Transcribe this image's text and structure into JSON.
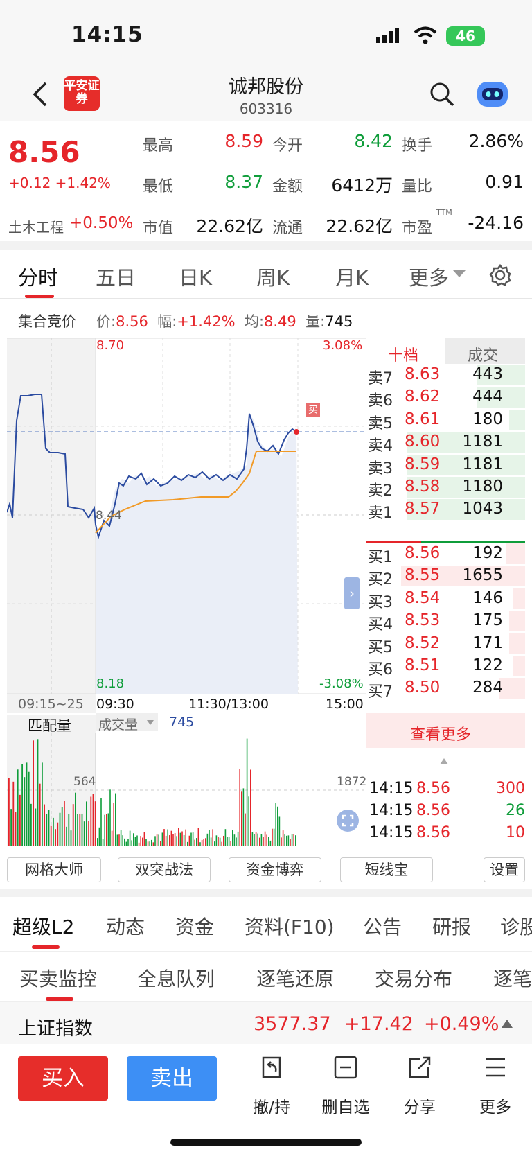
{
  "status": {
    "time": "14:15",
    "battery": "46"
  },
  "header": {
    "title": "诚邦股份",
    "code": "603316",
    "logo": "平安证券"
  },
  "quote": {
    "price": "8.56",
    "change": "+0.12 +1.42%",
    "high_label": "最高",
    "high": "8.59",
    "open_label": "今开",
    "open": "8.42",
    "turn_label": "换手",
    "turn": "2.86%",
    "low_label": "最低",
    "low": "8.37",
    "amt_label": "金额",
    "amt": "6412万",
    "vr_label": "量比",
    "vr": "0.91",
    "sector": "土木工程",
    "sector_chg": "+0.50%",
    "mcap_label": "市值",
    "mcap": "22.62亿",
    "float_label": "流通",
    "float": "22.62亿",
    "pe_label": "市盈",
    "pe_sup": "TTM",
    "pe": "-24.16"
  },
  "chart_tabs": [
    "分时",
    "五日",
    "日K",
    "周K",
    "月K",
    "更多"
  ],
  "info": {
    "auction": "集合竞价",
    "price_label": "价:",
    "price": "8.56",
    "amp_label": "幅:",
    "amp": "+1.42%",
    "avg_label": "均:",
    "avg": "8.49",
    "vol_label": "量:",
    "vol": "745"
  },
  "chart": {
    "ymax": "8.70",
    "ymin": "8.18",
    "pmax": "3.08%",
    "pmin": "-3.08%",
    "mid": "8.44",
    "buy_tag": "买",
    "x0": "09:15~25",
    "x1": "09:30",
    "x2": "11:30/13:00",
    "x3": "15:00",
    "match_label": "匹配量",
    "vol_label": "成交量",
    "vol_val": "745",
    "vol_left": "564",
    "vol_right": "1872"
  },
  "chart_data": {
    "type": "line",
    "title": "",
    "series": [
      {
        "name": "价",
        "values": [
          8.44,
          8.47,
          8.5,
          8.48,
          8.46,
          8.49,
          8.47,
          8.5,
          8.48,
          8.49,
          8.47,
          8.5,
          8.49,
          8.51,
          8.5,
          8.49,
          8.57,
          8.53,
          8.54,
          8.55,
          8.55,
          8.56
        ]
      },
      {
        "name": "均",
        "values": [
          8.41,
          8.42,
          8.43,
          8.44,
          8.44,
          8.45,
          8.46,
          8.46,
          8.46,
          8.46,
          8.46,
          8.46,
          8.46,
          8.47,
          8.48,
          8.49,
          8.49,
          8.49,
          8.49,
          8.49,
          8.49,
          8.49
        ]
      }
    ],
    "ylim": [
      8.18,
      8.7
    ]
  },
  "orderbook": {
    "tab1": "十档",
    "tab2": "成交",
    "sell": [
      {
        "l": "卖7",
        "p": "8.63",
        "v": "443"
      },
      {
        "l": "卖6",
        "p": "8.62",
        "v": "444"
      },
      {
        "l": "卖5",
        "p": "8.61",
        "v": "180"
      },
      {
        "l": "卖4",
        "p": "8.60",
        "v": "1181"
      },
      {
        "l": "卖3",
        "p": "8.59",
        "v": "1181"
      },
      {
        "l": "卖2",
        "p": "8.58",
        "v": "1180"
      },
      {
        "l": "卖1",
        "p": "8.57",
        "v": "1043"
      }
    ],
    "buy": [
      {
        "l": "买1",
        "p": "8.56",
        "v": "192"
      },
      {
        "l": "买2",
        "p": "8.55",
        "v": "1655"
      },
      {
        "l": "买3",
        "p": "8.54",
        "v": "146"
      },
      {
        "l": "买4",
        "p": "8.53",
        "v": "175"
      },
      {
        "l": "买5",
        "p": "8.52",
        "v": "171"
      },
      {
        "l": "买6",
        "p": "8.51",
        "v": "122"
      },
      {
        "l": "买7",
        "p": "8.50",
        "v": "284"
      }
    ],
    "more": "查看更多",
    "ticks": [
      {
        "t": "14:15",
        "p": "8.56",
        "v": "300"
      },
      {
        "t": "14:15",
        "p": "8.56",
        "v": "26"
      },
      {
        "t": "14:15",
        "p": "8.56",
        "v": "10"
      }
    ]
  },
  "tools": [
    "网格大师",
    "双突战法",
    "资金博弈",
    "短线宝",
    "设置"
  ],
  "tabs2": [
    "超级L2",
    "动态",
    "资金",
    "资料(F10)",
    "公告",
    "研报",
    "诊股"
  ],
  "tabs3": [
    "买卖监控",
    "全息队列",
    "逐笔还原",
    "交易分布",
    "逐笔"
  ],
  "index": {
    "name": "上证指数",
    "val": "3577.37",
    "chg": "+17.42",
    "pct": "+0.49%"
  },
  "actions": {
    "buy": "买入",
    "sell": "卖出",
    "a1": "撤/持",
    "a2": "删自选",
    "a3": "分享",
    "a4": "更多"
  }
}
